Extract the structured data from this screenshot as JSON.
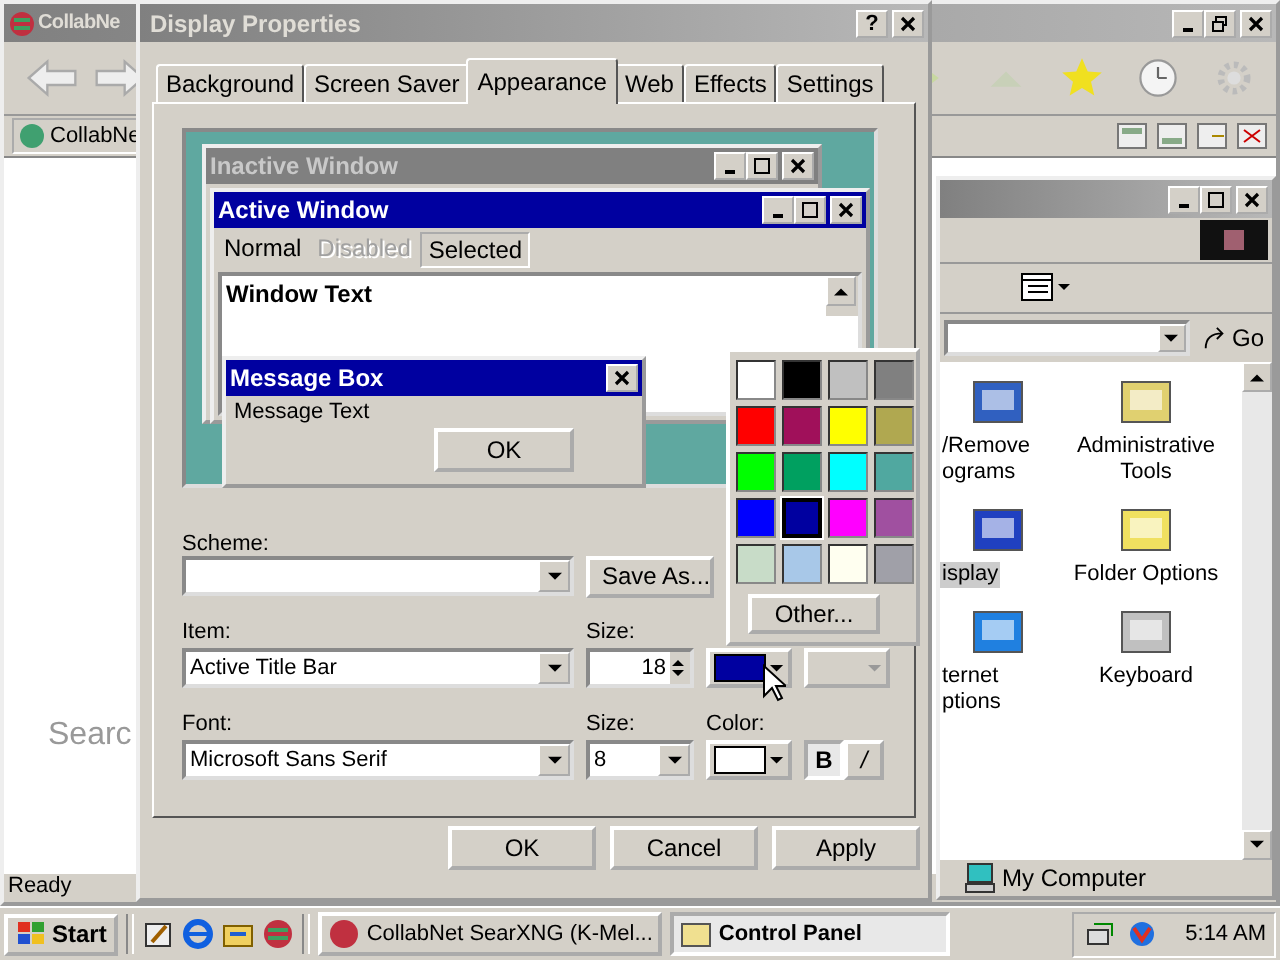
{
  "browser": {
    "title": "CollabNe",
    "tab": "CollabNe",
    "search_text": "Searc",
    "status": "Ready"
  },
  "control_panel": {
    "go": "Go",
    "items": [
      {
        "lines": [
          "/Remove",
          "ograms"
        ],
        "kind": "programs",
        "selected": false
      },
      {
        "lines": [
          "Administrative",
          "Tools"
        ],
        "kind": "tools",
        "selected": false
      },
      {
        "lines": [
          "isplay"
        ],
        "kind": "display",
        "selected": true
      },
      {
        "lines": [
          "Folder Options"
        ],
        "kind": "folder",
        "selected": false
      },
      {
        "lines": [
          "ternet",
          "ptions"
        ],
        "kind": "internet",
        "selected": false
      },
      {
        "lines": [
          "Keyboard"
        ],
        "kind": "keyboard",
        "selected": false
      }
    ],
    "status": "My Computer"
  },
  "dialog": {
    "title": "Display Properties",
    "help": "?",
    "tabs": [
      {
        "label": "Background",
        "selected": false
      },
      {
        "label": "Screen Saver",
        "selected": false
      },
      {
        "label": "Appearance",
        "selected": true
      },
      {
        "label": "Web",
        "selected": false
      },
      {
        "label": "Effects",
        "selected": false
      },
      {
        "label": "Settings",
        "selected": false
      }
    ],
    "preview": {
      "inactive_title": "Inactive Window",
      "active_title": "Active Window",
      "menu": [
        {
          "label": "Normal",
          "kind": "normal"
        },
        {
          "label": "Disabled",
          "kind": "disabled"
        },
        {
          "label": "Selected",
          "kind": "selected"
        }
      ],
      "window_text": "Window Text",
      "message_title": "Message Box",
      "message_text": "Message Text",
      "ok": "OK"
    },
    "scheme_label": "Scheme:",
    "save_as": "Save As...",
    "item_label": "Item:",
    "item_value": "Active Title Bar",
    "size_label": "Size:",
    "size_value": "18",
    "font_label": "Font:",
    "font_value": "Microsoft Sans Serif",
    "font_size_label": "Size:",
    "font_size_value": "8",
    "color_label": "Color:",
    "bold": "B",
    "italic": "/",
    "color_picker": {
      "other": "Other...",
      "swatches": [
        {
          "color": "#ffffff",
          "selected": false
        },
        {
          "color": "#000000",
          "selected": false
        },
        {
          "color": "#c0c0c0",
          "selected": false
        },
        {
          "color": "#808080",
          "selected": false
        },
        {
          "color": "#ff0000",
          "selected": false
        },
        {
          "color": "#a0105a",
          "selected": false
        },
        {
          "color": "#ffff00",
          "selected": false
        },
        {
          "color": "#b0a850",
          "selected": false
        },
        {
          "color": "#00ff00",
          "selected": false
        },
        {
          "color": "#00a060",
          "selected": false
        },
        {
          "color": "#00ffff",
          "selected": false
        },
        {
          "color": "#50a8a0",
          "selected": false
        },
        {
          "color": "#0000ff",
          "selected": false
        },
        {
          "color": "#0000a0",
          "selected": true
        },
        {
          "color": "#ff00ff",
          "selected": false
        },
        {
          "color": "#a050a0",
          "selected": false
        },
        {
          "color": "#c8dcc8",
          "selected": false
        },
        {
          "color": "#a8c8e8",
          "selected": false
        },
        {
          "color": "#fffff0",
          "selected": false
        },
        {
          "color": "#a0a0a8",
          "selected": false
        }
      ]
    },
    "buttons": [
      "OK",
      "Cancel",
      "Apply"
    ]
  },
  "taskbar": {
    "start": "Start",
    "tasks": [
      {
        "label": "CollabNet SearXNG (K-Mel...",
        "selected": false
      },
      {
        "label": "Control Panel",
        "selected": true
      }
    ],
    "clock": "5:14 AM"
  }
}
